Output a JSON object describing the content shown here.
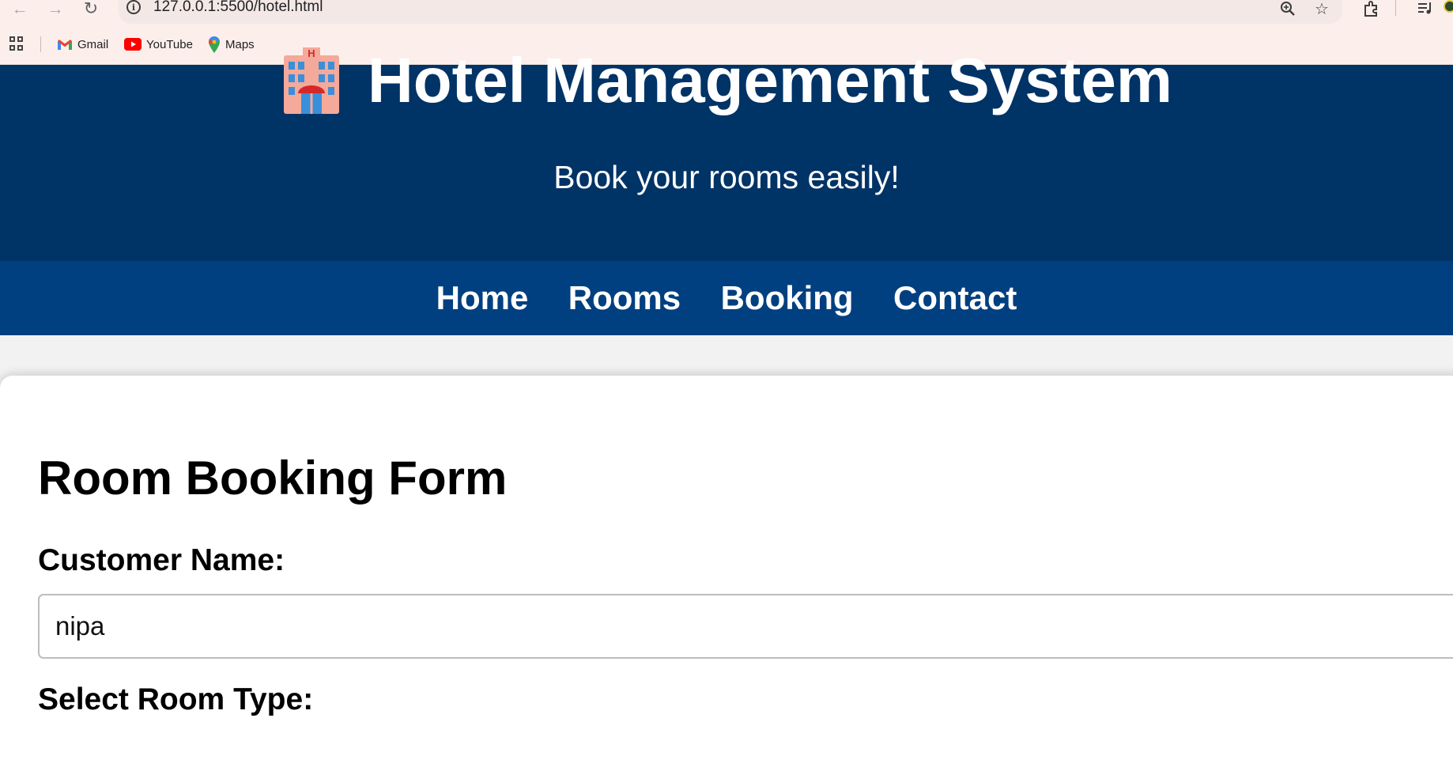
{
  "browser": {
    "url": "127.0.0.1:5500/hotel.html",
    "bookmarks": [
      {
        "label": "Gmail",
        "icon": "gmail-icon"
      },
      {
        "label": "YouTube",
        "icon": "youtube-icon"
      },
      {
        "label": "Maps",
        "icon": "maps-icon"
      }
    ]
  },
  "header": {
    "title": "Hotel Management System",
    "title_icon": "hotel-building-icon",
    "subtitle": "Book your rooms easily!"
  },
  "nav": {
    "items": [
      "Home",
      "Rooms",
      "Booking",
      "Contact"
    ]
  },
  "form": {
    "title": "Room Booking Form",
    "customer_name_label": "Customer Name:",
    "customer_name_value": "nipa",
    "room_type_label": "Select Room Type:"
  },
  "colors": {
    "header_bg": "#003366",
    "nav_bg": "#004080",
    "page_bg": "#f2f2f2",
    "chrome_bg": "#fcefeb"
  }
}
